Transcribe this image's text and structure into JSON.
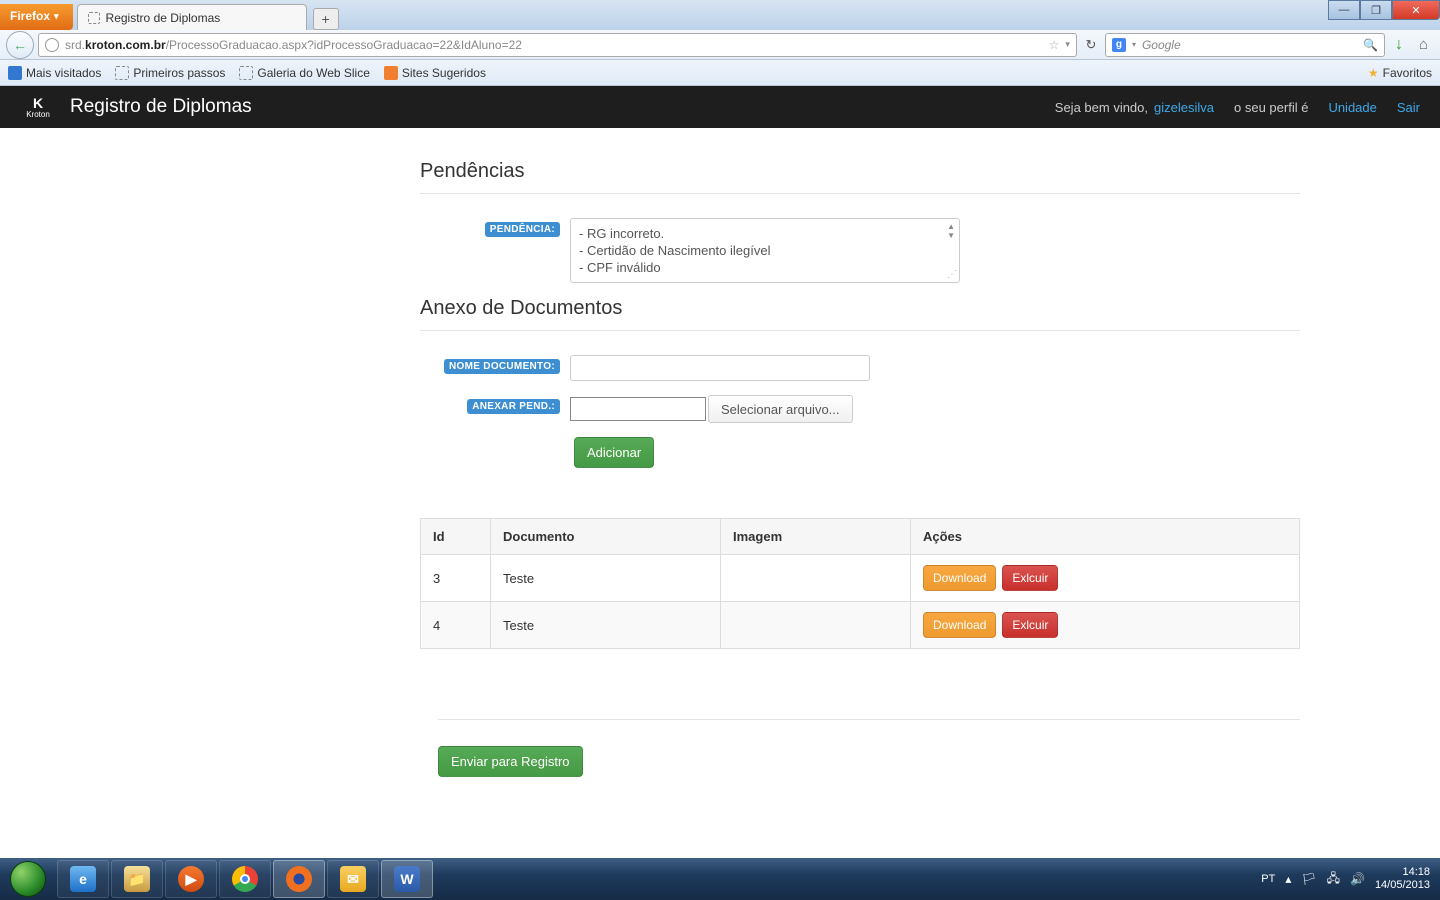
{
  "browser": {
    "name": "Firefox",
    "tab_title": "Registro de Diplomas",
    "newtab": "+",
    "url_prefix": "srd.",
    "url_host": "kroton.com.br",
    "url_path": "/ProcessoGraduacao.aspx?idProcessoGraduacao=22&IdAluno=22",
    "faded_title": "",
    "search_placeholder": "Google",
    "bookmarks": {
      "mais_visitados": "Mais visitados",
      "primeiros_passos": "Primeiros passos",
      "galeria": "Galeria do Web Slice",
      "sites_sugeridos": "Sites Sugeridos",
      "favoritos": "Favoritos"
    }
  },
  "app": {
    "brand": "Kroton",
    "title": "Registro de Diplomas",
    "welcome": "Seja bem vindo,",
    "username": "gizelesilva",
    "perfil_text": "o seu perfil é",
    "link_unidade": "Unidade",
    "link_sair": "Sair"
  },
  "sections": {
    "pendencias": "Pendências",
    "anexo": "Anexo de Documentos"
  },
  "labels": {
    "pendencia": "PENDÊNCIA:",
    "nome_documento": "NOME DOCUMENTO:",
    "anexar_pend": "ANEXAR PEND.:"
  },
  "pendencias_list": [
    "- RG incorreto.",
    "- Certidão de Nascimento ilegível",
    "- CPF inválido"
  ],
  "buttons": {
    "selecionar_arquivo": "Selecionar arquivo...",
    "adicionar": "Adicionar",
    "enviar": "Enviar para Registro",
    "download": "Download",
    "excluir": "Exlcuir"
  },
  "table": {
    "headers": {
      "id": "Id",
      "documento": "Documento",
      "imagem": "Imagem",
      "acoes": "Ações"
    },
    "rows": [
      {
        "id": "3",
        "documento": "Teste",
        "imagem": ""
      },
      {
        "id": "4",
        "documento": "Teste",
        "imagem": ""
      }
    ]
  },
  "tray": {
    "lang": "PT",
    "time": "14:18",
    "date": "14/05/2013"
  }
}
